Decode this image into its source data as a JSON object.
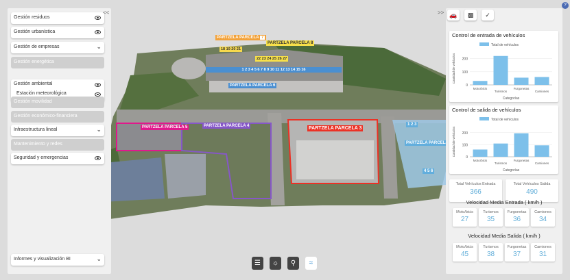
{
  "left_panel": {
    "collapse_label": "<<",
    "items": [
      {
        "label": "Gestión residuos",
        "state": "enabled",
        "icon": "eye-icon"
      },
      {
        "label": "Gestión urbanística",
        "state": "enabled",
        "icon": "eye-icon"
      },
      {
        "label": "Gestión de empresas",
        "state": "enabled",
        "icon": "chevron-down-icon"
      },
      {
        "label": "Gestión energética",
        "state": "disabled"
      },
      {
        "label": "Gestión ambiental",
        "state": "enabled",
        "icon": "eye-icon"
      },
      {
        "label": "Estación meteorológica",
        "state": "enabled",
        "icon": "eye-icon"
      },
      {
        "label": "Gestión movilidad",
        "state": "disabled"
      },
      {
        "label": "Gestión económico-financiera",
        "state": "disabled"
      },
      {
        "label": "Infraestructura lineal",
        "state": "enabled",
        "icon": "chevron-down-icon"
      },
      {
        "label": "Mantenimiento y redes",
        "state": "disabled"
      },
      {
        "label": "Seguridad y emergencias",
        "state": "enabled",
        "icon": "eye-icon"
      },
      {
        "label": "Informes y visualización BI",
        "state": "enabled",
        "icon": "chevron-down-icon"
      }
    ]
  },
  "right_panel": {
    "collapse_label": ">>",
    "toolbar_icons": [
      "car-icon",
      "building-icon",
      "pin-off-icon"
    ],
    "totals": [
      {
        "label": "Total Vehículos Entrada",
        "value": "366"
      },
      {
        "label": "Total Vehículos Salida",
        "value": "490"
      }
    ],
    "speed_in": {
      "title": "Velocidad Media Entrada ( km/h )",
      "items": [
        {
          "label": "Moto/bicis",
          "value": "27"
        },
        {
          "label": "Turismos",
          "value": "35"
        },
        {
          "label": "Furgonetas",
          "value": "36"
        },
        {
          "label": "Camiones",
          "value": "34"
        }
      ]
    },
    "speed_out": {
      "title": "Velocidad Media Salida  ( km/h )",
      "items": [
        {
          "label": "Moto/bicis",
          "value": "45"
        },
        {
          "label": "Turismos",
          "value": "38"
        },
        {
          "label": "Furgonetas",
          "value": "37"
        },
        {
          "label": "Camiones",
          "value": "31"
        }
      ]
    }
  },
  "chart_data": [
    {
      "type": "bar",
      "title": "Control de entrada de vehículos",
      "legend": "Total de vehículos",
      "categories": [
        "Motorbicis",
        "Turismos",
        "Furgonetas",
        "Camiones"
      ],
      "values": [
        30,
        220,
        55,
        60
      ],
      "xlabel": "Categorías",
      "ylabel": "Cantidad de vehículos",
      "ylim": [
        0,
        250
      ],
      "yticks": [
        0,
        100,
        200
      ],
      "color": "#7dc0ea"
    },
    {
      "type": "bar",
      "title": "Control de salida de vehículos",
      "legend": "Total de vehículos",
      "categories": [
        "Motorbicis",
        "Turismos",
        "Furgonetas",
        "Camiones"
      ],
      "values": [
        60,
        110,
        195,
        95
      ],
      "xlabel": "Categorías",
      "ylabel": "Cantidad de vehículos",
      "ylim": [
        0,
        250
      ],
      "yticks": [
        0,
        100,
        200
      ],
      "color": "#7dc0ea"
    }
  ],
  "map": {
    "labels": [
      {
        "text": "PARTZELA PARCELA",
        "num": "7"
      },
      {
        "text": "PARTZELA PARCELA",
        "num": "8"
      },
      {
        "text": "PARTZELA PARCELA",
        "num": "6"
      },
      {
        "text": "PARTZELA PARCELA",
        "num": "5"
      },
      {
        "text": "PARTZELA PARCELA",
        "num": "4"
      },
      {
        "text": "PARTZELA PARCELA",
        "num": "3"
      },
      {
        "text": "PARTZELA PARCELA",
        "num": ""
      }
    ],
    "row_numbers_top": "18 19 20 21",
    "row_numbers_yellow": "22 23 24 25 26 27",
    "row_numbers_blue": "1 2 3 4 5 6 7 8 9 10 11 12 13 14 15 16",
    "right_block_numbers": "1 2 3",
    "right_block_bottom": "4 5 6"
  },
  "bottom_toolbar": {
    "icons": [
      "layers-icon",
      "lightbulb-icon",
      "location-pin-icon",
      "wifi-icon"
    ],
    "active": "wifi-icon"
  },
  "help_label": "?"
}
